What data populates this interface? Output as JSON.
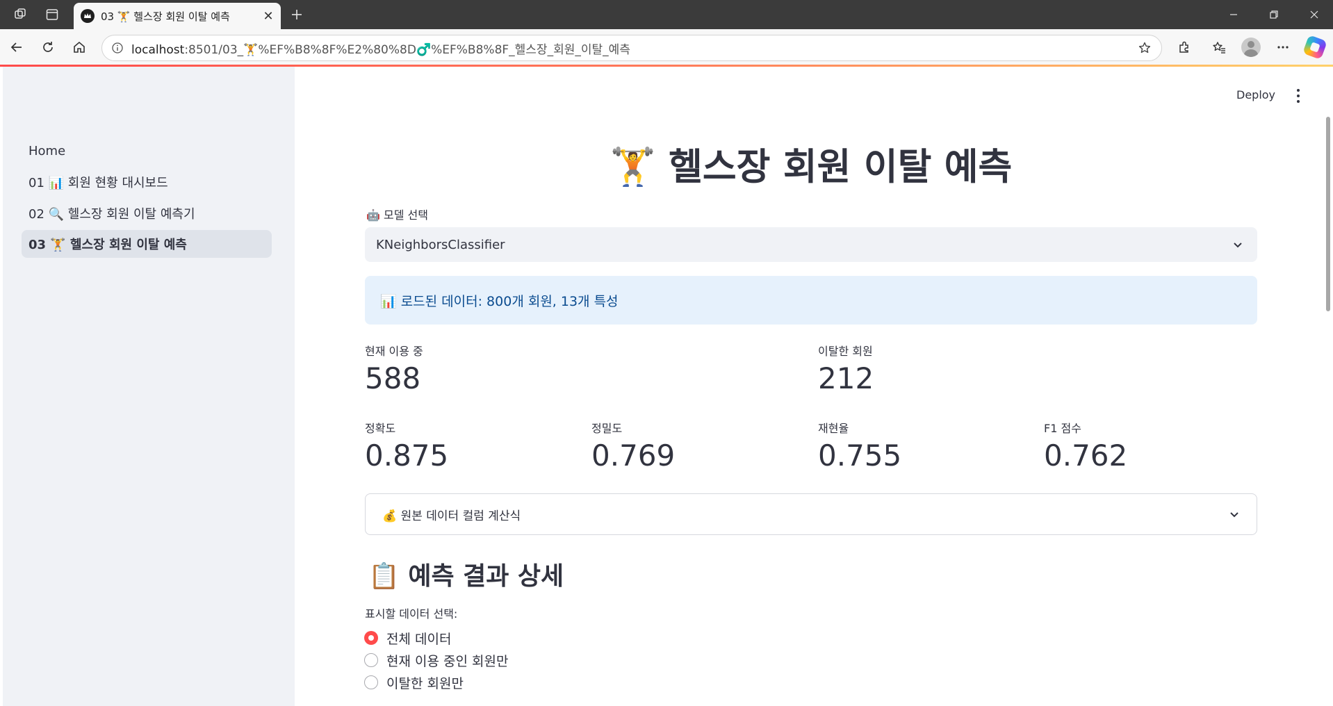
{
  "browser": {
    "tab_title": "03 🏋️ 헬스장 회원 이탈 예측",
    "url_host": "localhost",
    "url_path": ":8501/03_🏋️%EF%B8%8F%E2%80%8D♂️%EF%B8%8F_헬스장_회원_이탈_예측"
  },
  "sidebar": {
    "items": [
      {
        "label": "Home",
        "active": false
      },
      {
        "label": "01 📊 회원 현황 대시보드",
        "active": false
      },
      {
        "label": "02 🔍 헬스장 회원 이탈 예측기",
        "active": false
      },
      {
        "label": "03 🏋️ 헬스장 회원 이탈 예측",
        "active": true
      }
    ]
  },
  "header": {
    "deploy_label": "Deploy"
  },
  "main": {
    "title": "🏋️ 헬스장 회원 이탈 예측",
    "model_select": {
      "label": "🤖 모델 선택",
      "value": "KNeighborsClassifier"
    },
    "info": "📊 로드된 데이터: 800개 회원, 13개 특성",
    "metrics_top": [
      {
        "label": "현재 이용 중",
        "value": "588"
      },
      {
        "label": "이탈한 회원",
        "value": "212"
      }
    ],
    "metrics_scores": [
      {
        "label": "정확도",
        "value": "0.875"
      },
      {
        "label": "정밀도",
        "value": "0.769"
      },
      {
        "label": "재현율",
        "value": "0.755"
      },
      {
        "label": "F1 점수",
        "value": "0.762"
      }
    ],
    "expander_label": "💰 원본 데이터 컬럼 계산식",
    "section_title": "📋 예측 결과 상세",
    "radio": {
      "label": "표시할 데이터 선택:",
      "options": [
        "전체 데이터",
        "현재 이용 중인 회원만",
        "이탈한 회원만"
      ],
      "selected": "전체 데이터"
    }
  },
  "colors": {
    "accent": "#ff4b4b",
    "sidebar_bg": "#f0f2f6",
    "info_bg": "#e6f1fc",
    "info_text": "#0a4b8f"
  }
}
